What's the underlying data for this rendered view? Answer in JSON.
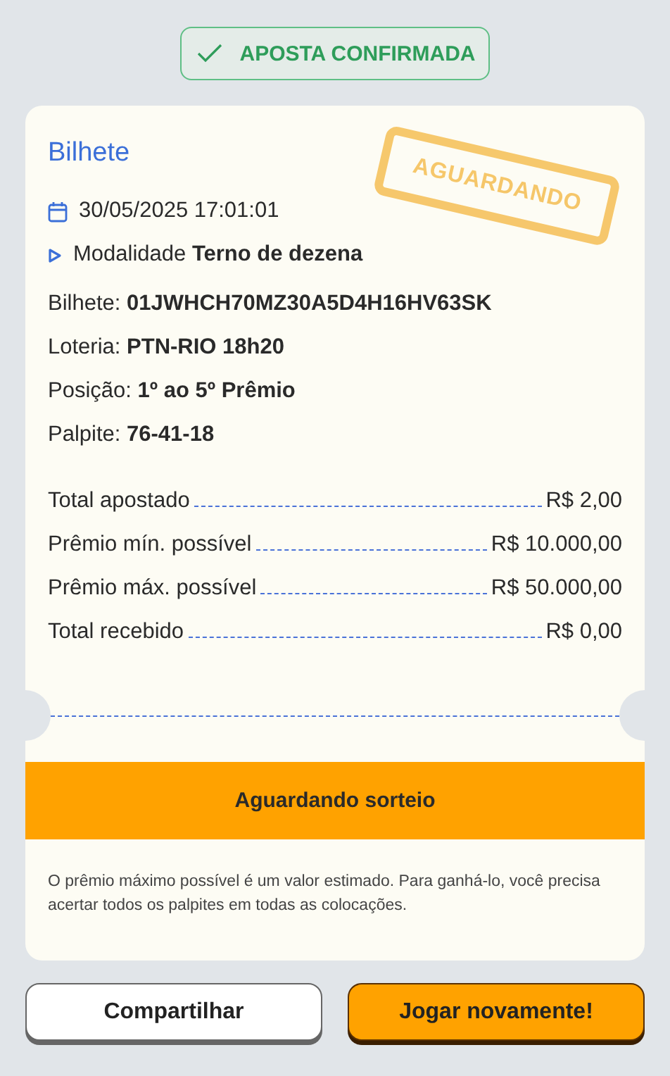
{
  "status_badge": {
    "text": "APOSTA CONFIRMADA"
  },
  "ticket": {
    "title": "Bilhete",
    "stamp": "AGUARDANDO",
    "datetime": "30/05/2025 17:01:01",
    "modality": "Modalidade **Terno de dezena**",
    "details": [
      "Bilhete: **01JWHCH70MZ30A5D4H16HV63SK**",
      "Loteria: **PTN-RIO 18h20**",
      "Posição: **1º ao 5º Prêmio**",
      "Palpite: **76-41-18**"
    ],
    "totals": [
      {
        "label": "Total apostado",
        "value": "R$ 2,00"
      },
      {
        "label": "Prêmio mín. possível",
        "value": "R$ 10.000,00"
      },
      {
        "label": "Prêmio máx. possível",
        "value": "R$ 50.000,00"
      },
      {
        "label": "Total recebido",
        "value": "R$ 0,00"
      }
    ],
    "status_bar": "Aguardando sorteio",
    "note": "O prêmio máximo possível é um valor estimado. Para ganhá-lo, você precisa acertar todos os palpites em todas as colocações."
  },
  "buttons": [
    {
      "label": "Compartilhar",
      "kind": "secondary"
    },
    {
      "label": "Jogar novamente!",
      "kind": "primary"
    }
  ]
}
